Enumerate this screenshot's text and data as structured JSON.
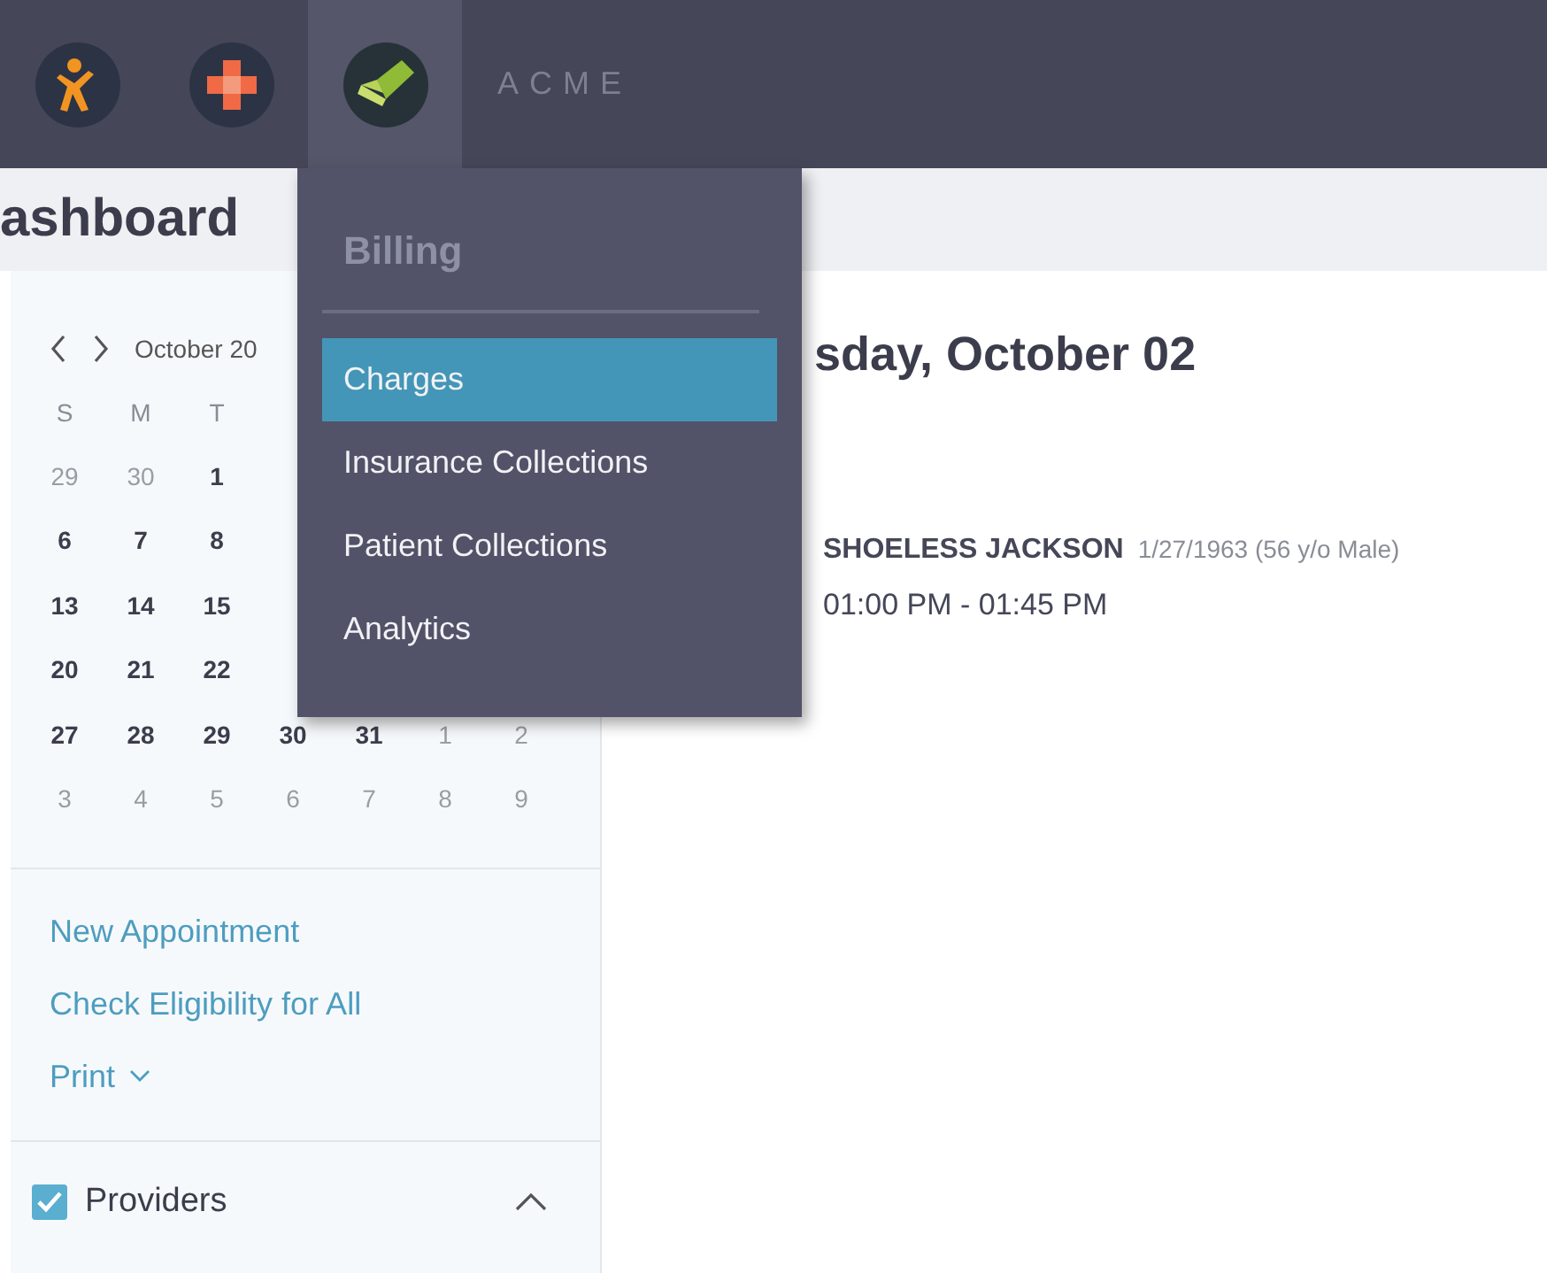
{
  "topbar": {
    "apps": [
      {
        "kind": "person",
        "selected": false
      },
      {
        "kind": "bandage",
        "selected": false
      },
      {
        "kind": "billing",
        "selected": true
      }
    ],
    "brand": "ACME"
  },
  "page_title": "ashboard",
  "calendar": {
    "title": "October 20",
    "weekdays": [
      "S",
      "M",
      "T"
    ],
    "weeks": [
      [
        {
          "text": "29",
          "muted": true,
          "selected": false
        },
        {
          "text": "30",
          "muted": true,
          "selected": false
        },
        {
          "text": "1",
          "muted": false,
          "selected": false
        }
      ],
      [
        {
          "text": "6",
          "muted": false,
          "selected": false
        },
        {
          "text": "7",
          "muted": false,
          "selected": false
        },
        {
          "text": "8",
          "muted": false,
          "selected": false
        }
      ],
      [
        {
          "text": "13",
          "muted": false,
          "selected": false
        },
        {
          "text": "14",
          "muted": false,
          "selected": false
        },
        {
          "text": "15",
          "muted": false,
          "selected": false
        }
      ],
      [
        {
          "text": "20",
          "muted": false,
          "selected": false
        },
        {
          "text": "21",
          "muted": false,
          "selected": false
        },
        {
          "text": "22",
          "muted": false,
          "selected": false
        }
      ],
      [
        {
          "text": "27",
          "muted": false,
          "selected": false
        },
        {
          "text": "28",
          "muted": false,
          "selected": false
        },
        {
          "text": "29",
          "muted": false,
          "selected": false
        },
        {
          "text": "30",
          "muted": false,
          "selected": false
        },
        {
          "text": "31",
          "muted": false,
          "selected": false
        },
        {
          "text": "1",
          "muted": true,
          "selected": false
        },
        {
          "text": "2",
          "muted": true,
          "selected": false
        }
      ],
      [
        {
          "text": "3",
          "muted": true,
          "selected": false
        },
        {
          "text": "4",
          "muted": true,
          "selected": false
        },
        {
          "text": "5",
          "muted": true,
          "selected": false
        },
        {
          "text": "6",
          "muted": true,
          "selected": false
        },
        {
          "text": "7",
          "muted": true,
          "selected": false
        },
        {
          "text": "8",
          "muted": true,
          "selected": false
        },
        {
          "text": "9",
          "muted": true,
          "selected": false
        }
      ]
    ]
  },
  "actions": [
    {
      "label": "New Appointment",
      "kind": "link"
    },
    {
      "label": "Check Eligibility for All",
      "kind": "link"
    },
    {
      "label": "Print",
      "kind": "dropdown"
    }
  ],
  "providers": {
    "label": "Providers",
    "checked": true,
    "expanded": true
  },
  "day_heading": "sday, October 02",
  "appointments": [
    {
      "patient": "SHOELESS JACKSON",
      "details": "1/27/1963 (56 y/o Male)",
      "time": "01:00 PM - 01:45 PM"
    }
  ],
  "billing_menu": {
    "title": "Billing",
    "items": [
      {
        "label": "Charges",
        "selected": true
      },
      {
        "label": "Insurance Collections",
        "selected": false
      },
      {
        "label": "Patient Collections",
        "selected": false
      },
      {
        "label": "Analytics",
        "selected": false
      }
    ]
  }
}
